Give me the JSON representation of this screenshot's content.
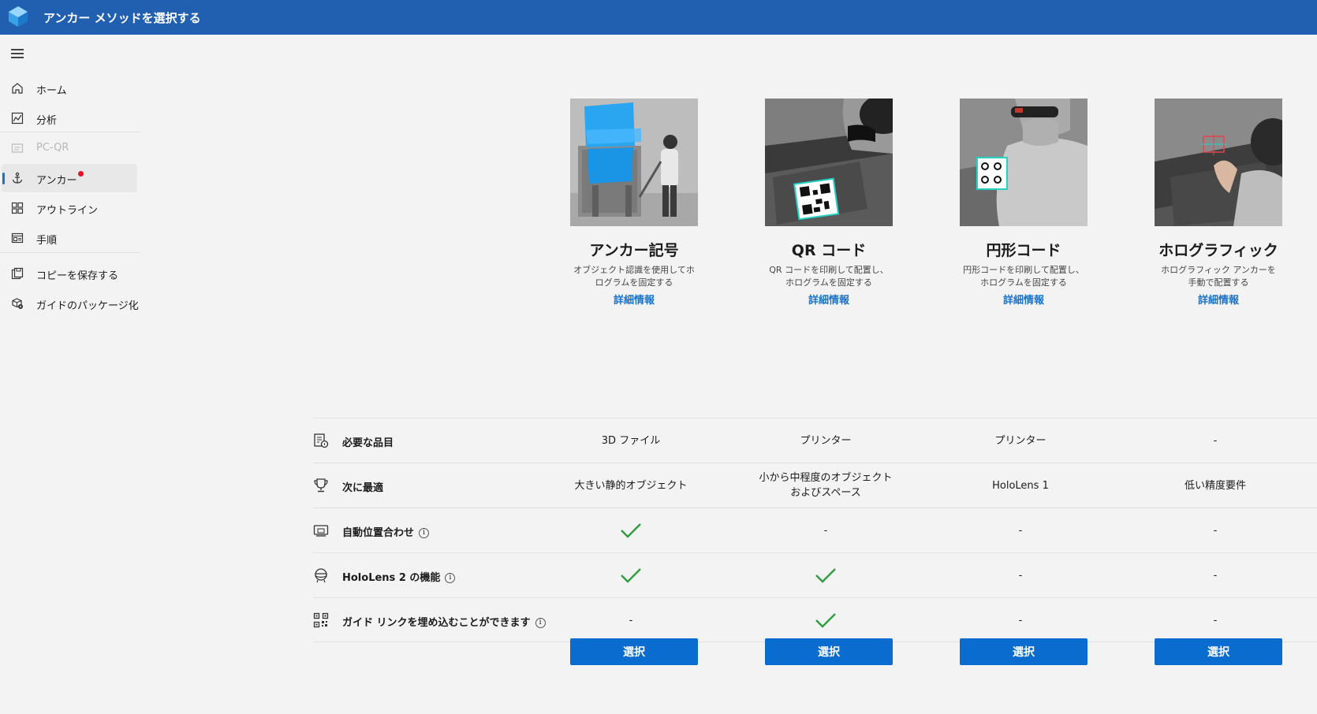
{
  "window": {
    "title": "アンカー メソッドを選択する"
  },
  "sidebar": {
    "items": [
      {
        "label": "ホーム"
      },
      {
        "label": "分析"
      },
      {
        "label": "PC-QR"
      },
      {
        "label": "アンカー"
      },
      {
        "label": "アウトライン"
      },
      {
        "label": "手順"
      },
      {
        "label": "コピーを保存する"
      },
      {
        "label": "ガイドのパッケージ化"
      }
    ]
  },
  "cards": [
    {
      "title": "アンカー記号",
      "desc": "オブジェクト認識を使用してホログラムを固定する",
      "link": "詳細情報",
      "button": "選択"
    },
    {
      "title": "QR コード",
      "desc": "QR コードを印刷して配置し、ホログラムを固定する",
      "link": "詳細情報",
      "button": "選択"
    },
    {
      "title": "円形コード",
      "desc": "円形コードを印刷して配置し、ホログラムを固定する",
      "link": "詳細情報",
      "button": "選択"
    },
    {
      "title": "ホログラフィック",
      "desc": "ホログラフィック アンカーを手動で配置する",
      "link": "詳細情報",
      "button": "選択"
    }
  ],
  "table": {
    "rows": [
      {
        "label": "必要な品目",
        "info": false,
        "cells": [
          "3D ファイル",
          "プリンター",
          "プリンター",
          "-"
        ]
      },
      {
        "label": "次に最適",
        "info": false,
        "cells": [
          "大きい静的オブジェクト",
          "小から中程度のオブジェクトおよびスペース",
          "HoloLens 1",
          "低い精度要件"
        ]
      },
      {
        "label": "自動位置合わせ",
        "info": true,
        "cells": [
          "check",
          "-",
          "-",
          "-"
        ]
      },
      {
        "label": "HoloLens 2 の機能",
        "info": true,
        "cells": [
          "check",
          "check",
          "-",
          "-"
        ]
      },
      {
        "label": "ガイド リンクを埋め込むことができます",
        "info": true,
        "cells": [
          "-",
          "check",
          "-",
          "-"
        ]
      }
    ]
  },
  "colors": {
    "titlebar": "#2160b0",
    "accent": "#0a6cce",
    "check": "#2e9d3e",
    "badge": "#e81123"
  }
}
